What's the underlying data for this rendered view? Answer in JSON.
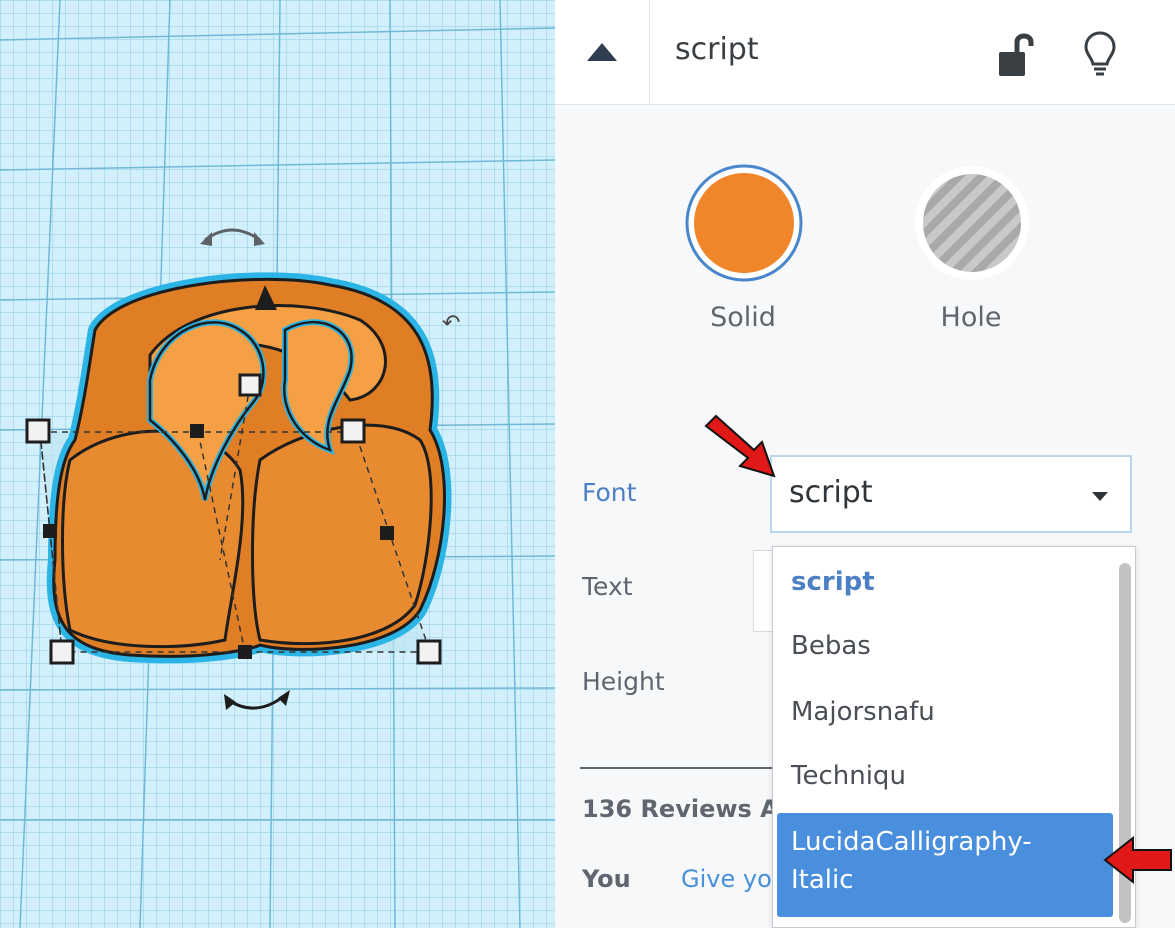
{
  "header": {
    "shape_name": "script",
    "collapse_icon": "triangle-up-icon",
    "lock_icon": "unlocked-padlock-icon",
    "bulb_icon": "lightbulb-icon"
  },
  "swatches": {
    "solid_label": "Solid",
    "hole_label": "Hole",
    "solid_color": "#f0862a"
  },
  "properties": {
    "font_label": "Font",
    "font_value": "script",
    "text_label": "Text",
    "height_label": "Height",
    "height_value_fragment": "("
  },
  "font_options": [
    {
      "label": "script",
      "state": "selected"
    },
    {
      "label": "Bebas",
      "state": "normal"
    },
    {
      "label": "Majorsnafu",
      "state": "normal"
    },
    {
      "label": "Techniqu",
      "state": "normal"
    },
    {
      "label_line1": "LucidaCalligraphy-",
      "label_line2": "Italic",
      "state": "highlighted"
    }
  ],
  "reviews": {
    "count_text": "136 Reviews A",
    "you_label": "You",
    "give_link": "Give yo"
  },
  "colors": {
    "grid_bg": "#c9ecf8",
    "shape_orange": "#f0862a",
    "selection_outline": "#2bb4e6",
    "highlight_blue": "#4a8fdd",
    "annotation_red": "#e01818"
  }
}
